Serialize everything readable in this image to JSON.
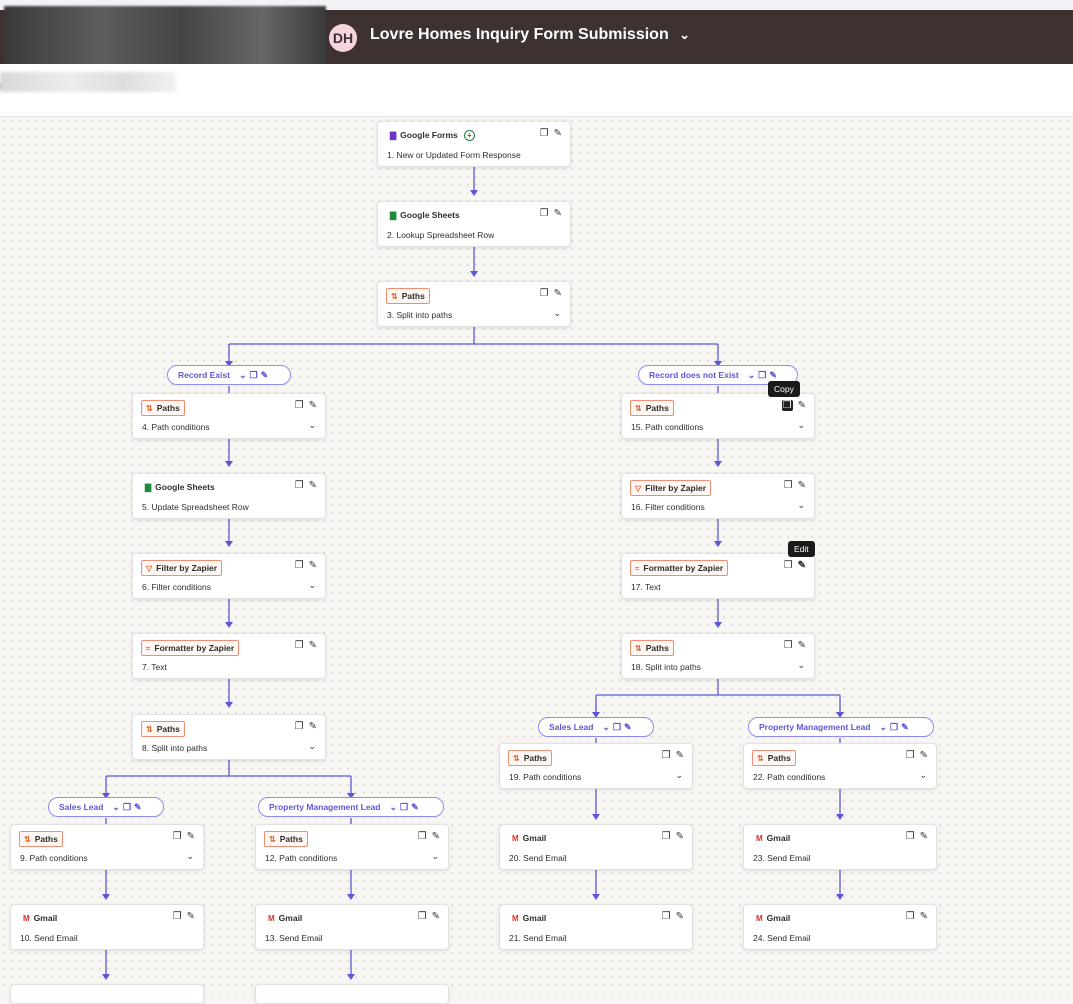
{
  "header": {
    "avatar_initials": "DH",
    "zap_title": "Lovre Homes Inquiry Form Submission",
    "title_chevron": "⌄"
  },
  "subbar": {
    "breadcrumb_fragment": "ra"
  },
  "colors": {
    "header_bg": "#3e3231",
    "accent": "#5b58d6",
    "path_tag": "#ee8f73"
  },
  "steps": [
    {
      "id": "1",
      "app": "Google Forms",
      "app_icon": "google-forms-icon",
      "label": "1. New or Updated Form Response"
    },
    {
      "id": "2",
      "app": "Google Sheets",
      "app_icon": "google-sheets-icon",
      "label": "2. Lookup Spreadsheet Row"
    },
    {
      "id": "3",
      "app": "Paths",
      "app_icon": "paths-icon",
      "label": "3. Split into paths"
    },
    {
      "id": "4",
      "app": "Paths",
      "app_icon": "paths-icon",
      "label": "4. Path conditions"
    },
    {
      "id": "5",
      "app": "Google Sheets",
      "app_icon": "google-sheets-icon",
      "label": "5. Update Spreadsheet Row"
    },
    {
      "id": "6",
      "app": "Filter by Zapier",
      "app_icon": "filter-icon",
      "label": "6. Filter conditions"
    },
    {
      "id": "7",
      "app": "Formatter by Zapier",
      "app_icon": "formatter-icon",
      "label": "7. Text"
    },
    {
      "id": "8",
      "app": "Paths",
      "app_icon": "paths-icon",
      "label": "8. Split into paths"
    },
    {
      "id": "9",
      "app": "Paths",
      "app_icon": "paths-icon",
      "label": "9. Path conditions"
    },
    {
      "id": "10",
      "app": "Gmail",
      "app_icon": "gmail-icon",
      "label": "10. Send Email"
    },
    {
      "id": "12",
      "app": "Paths",
      "app_icon": "paths-icon",
      "label": "12. Path conditions"
    },
    {
      "id": "13",
      "app": "Gmail",
      "app_icon": "gmail-icon",
      "label": "13. Send Email"
    },
    {
      "id": "15",
      "app": "Paths",
      "app_icon": "paths-icon",
      "label": "15. Path conditions"
    },
    {
      "id": "16",
      "app": "Filter by Zapier",
      "app_icon": "filter-icon",
      "label": "16. Filter conditions"
    },
    {
      "id": "17",
      "app": "Formatter by Zapier",
      "app_icon": "formatter-icon",
      "label": "17. Text"
    },
    {
      "id": "18",
      "app": "Paths",
      "app_icon": "paths-icon",
      "label": "18. Split into paths"
    },
    {
      "id": "19",
      "app": "Paths",
      "app_icon": "paths-icon",
      "label": "19. Path conditions"
    },
    {
      "id": "20",
      "app": "Gmail",
      "app_icon": "gmail-icon",
      "label": "20. Send Email"
    },
    {
      "id": "21",
      "app": "Gmail",
      "app_icon": "gmail-icon",
      "label": "21. Send Email"
    },
    {
      "id": "22",
      "app": "Paths",
      "app_icon": "paths-icon",
      "label": "22. Path conditions"
    },
    {
      "id": "23",
      "app": "Gmail",
      "app_icon": "gmail-icon",
      "label": "23. Send Email"
    },
    {
      "id": "24",
      "app": "Gmail",
      "app_icon": "gmail-icon",
      "label": "24. Send Email"
    }
  ],
  "paths": [
    {
      "id": "record-exist",
      "label": "Record Exist"
    },
    {
      "id": "record-not-exist",
      "label": "Record does not Exist"
    },
    {
      "id": "sales-lead-left",
      "label": "Sales Lead"
    },
    {
      "id": "property-mgmt-left",
      "label": "Property Management Lead"
    },
    {
      "id": "sales-lead-right",
      "label": "Sales Lead"
    },
    {
      "id": "property-mgmt-right",
      "label": "Property Management Lead"
    }
  ],
  "tooltips": {
    "copy": "Copy",
    "edit": "Edit"
  },
  "icons": {
    "copy": "copy-icon",
    "edit": "pencil-icon",
    "expand": "chevron-down-icon",
    "add": "add-icon"
  }
}
